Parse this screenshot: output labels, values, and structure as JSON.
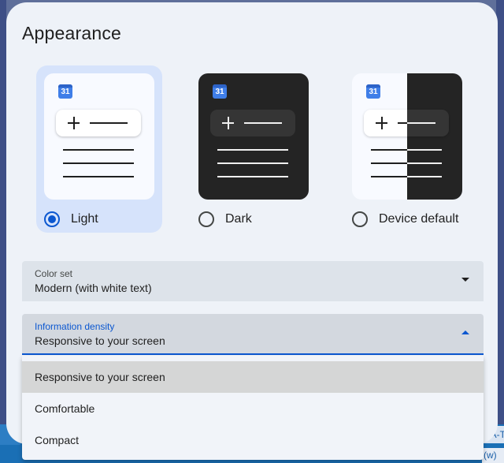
{
  "dialog": {
    "title": "Appearance"
  },
  "themes": [
    {
      "label": "Light",
      "selected": true,
      "icon_text": "31"
    },
    {
      "label": "Dark",
      "selected": false,
      "icon_text": "31"
    },
    {
      "label": "Device default",
      "selected": false,
      "icon_text": "31"
    }
  ],
  "color_set": {
    "label": "Color set",
    "value": "Modern (with white text)"
  },
  "information_density": {
    "label": "Information density",
    "value": "Responsive to your screen",
    "options": [
      "Responsive to your screen",
      "Comfortable",
      "Compact"
    ]
  },
  "background_fragments": {
    "right_1": "CA-T",
    "right_2": "(w)"
  },
  "colors": {
    "accent": "#0b57d0",
    "dialog_bg": "#eef2f8",
    "selected_card_bg": "#d6e3fb"
  }
}
